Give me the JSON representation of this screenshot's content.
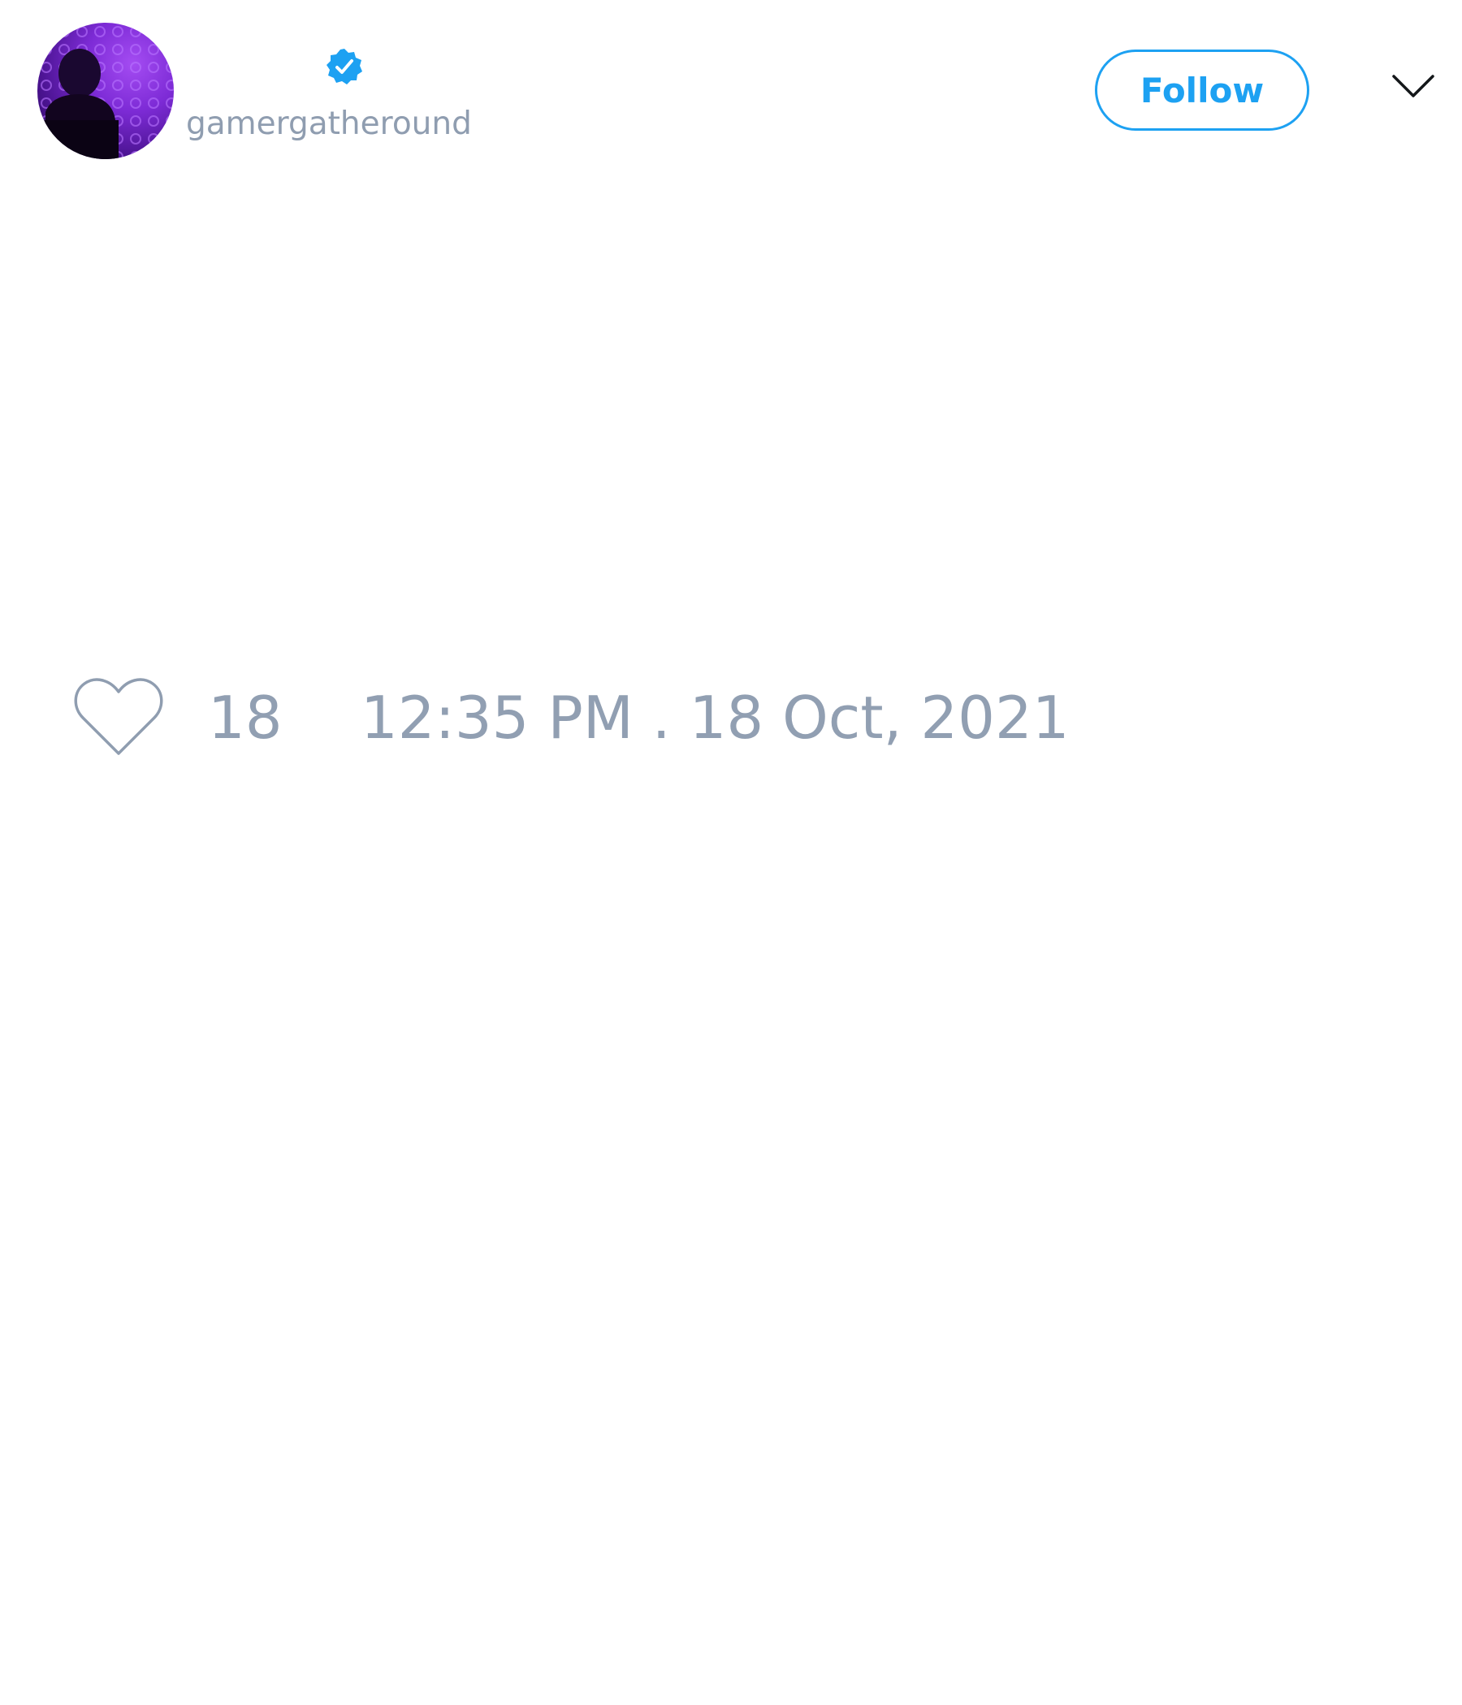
{
  "tweet": {
    "author": {
      "display_name": "",
      "handle": "gamergatheround",
      "verified": true,
      "avatar_icon": "avatar-image"
    },
    "follow_label": "Follow",
    "menu_icon": "chevron-down-icon",
    "likes": {
      "icon": "heart-icon",
      "count": "18"
    },
    "timestamp": "12:35 PM . 18 Oct, 2021"
  },
  "colors": {
    "accent": "#1da1f2",
    "muted_text": "#919fb2",
    "avatar_purple": "#7d2bd6"
  }
}
